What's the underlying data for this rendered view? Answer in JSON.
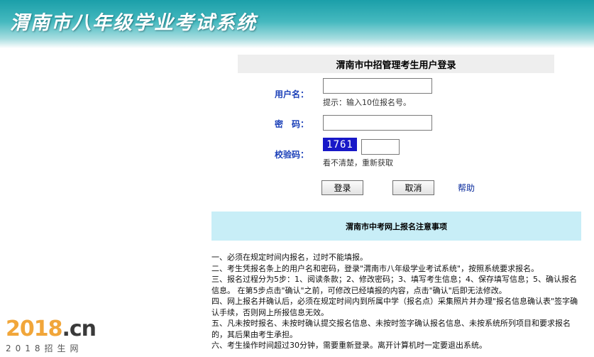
{
  "banner": {
    "title": "渭南市八年级学业考试系统"
  },
  "login": {
    "header": "渭南市中招管理考生用户登录",
    "username_label": "用户名：",
    "username_value": "",
    "username_hint": "提示：输入10位报名号。",
    "password_label": "密　码：",
    "password_value": "",
    "captcha_label": "校验码：",
    "captcha_code": "1761",
    "captcha_value": "",
    "captcha_refresh": "看不清楚，重新获取",
    "login_button": "登录",
    "cancel_button": "取消",
    "help_link": "帮助"
  },
  "notice": {
    "title": "渭南市中考网上报名注意事项",
    "items": [
      "一、必须在规定时间内报名，过时不能填报。",
      "二、考生凭报名条上的用户名和密码，登录\"渭南市八年级学业考试系统\"，按照系统要求报名。",
      "三、报名过程分为5步：1、阅读条款；2、修改密码；3、填写考生信息；4、保存填写信息；5、确认报名信息。 在第5步点击\"确认\"之前，可修改已经填报的内容，点击\"确认\"后即无法修改。",
      "四、网上报名并确认后，必须在规定时间内到所属中学（报名点）采集照片并办理\"报名信息确认表\"签字确认手续，否则网上所报信息无效。",
      "五、凡未按时报名、未按时确认提交报名信息、未按时签字确认报名信息、未按系统所列项目和要求报名的，其后果由考生承担。",
      "六、考生操作时间超过30分钟，需要重新登录。离开计算机时一定要退出系统。"
    ]
  },
  "watermark": {
    "logo_num": "2018",
    "logo_tld": ".cn",
    "subtitle": "2018招生网"
  }
}
